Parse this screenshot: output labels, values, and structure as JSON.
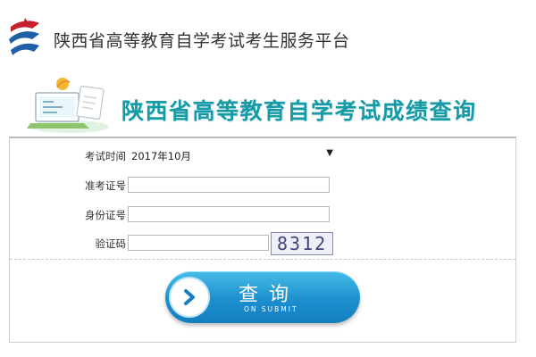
{
  "header": {
    "site_title": "陕西省高等教育自学考试考生服务平台",
    "logo_icon": "provincial-exam-logo"
  },
  "banner": {
    "title": "陕西省高等教育自学考试成绩查询",
    "art_icon": "laptop-document-icon"
  },
  "form": {
    "exam_time": {
      "label": "考试时间",
      "colon": "：",
      "selected": "2017年10月",
      "caret": "▼"
    },
    "ticket_number": {
      "label": "准考证号",
      "colon": "：",
      "value": ""
    },
    "id_number": {
      "label": "身份证号",
      "colon": "：",
      "value": ""
    },
    "captcha": {
      "label": "验证码",
      "colon": "：",
      "value": "",
      "code": "8312"
    }
  },
  "submit": {
    "label": "查询",
    "sublabel": "ON SUBMIT"
  },
  "colors": {
    "accent": "#159aa6",
    "button": "#1d8fce"
  }
}
